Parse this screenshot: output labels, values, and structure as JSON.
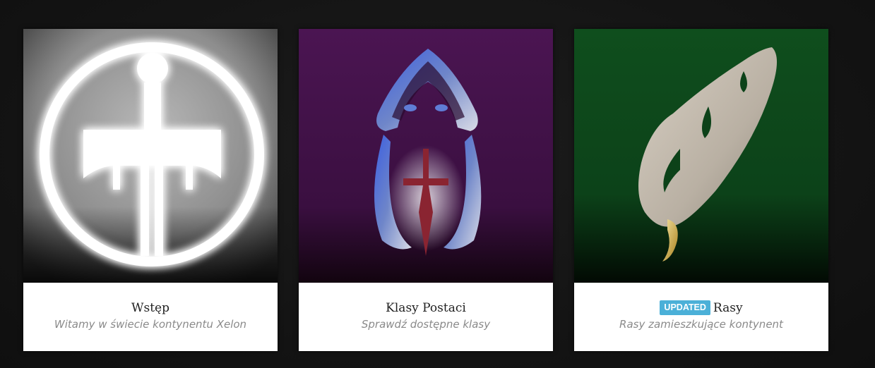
{
  "cards": [
    {
      "title": "Wstęp",
      "subtitle": "Witamy w świecie kontynentu Xelon",
      "icon": "sword-in-circle-icon",
      "bg": "#8a8a8a"
    },
    {
      "title": "Klasy Postaci",
      "subtitle": "Sprawdź dostępne klasy",
      "icon": "hooded-figure-dagger-icon",
      "bg": "#4a1450"
    },
    {
      "title": "Rasy",
      "badge": "UPDATED",
      "subtitle": "Rasy zamieszkujące kontynent",
      "icon": "elf-ear-icon",
      "bg": "#0d4a1c"
    }
  ],
  "colors": {
    "badge": "#4bb0d8"
  }
}
